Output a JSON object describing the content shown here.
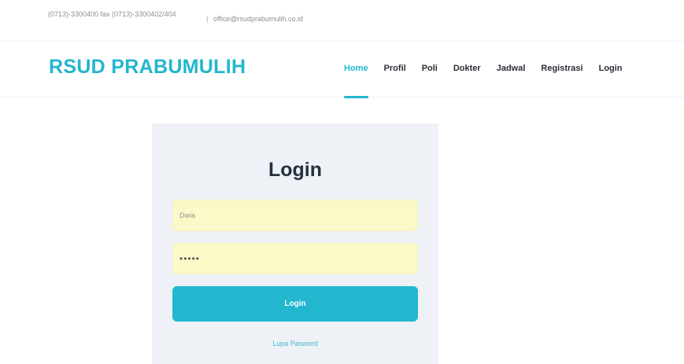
{
  "topbar": {
    "phone": "(0713)-3300400 fax (0713)-3300402/404",
    "separator": "|",
    "email": "office@rsudprabumulih.co.id"
  },
  "header": {
    "brand": "RSUD PRABUMULIH",
    "nav": {
      "home": "Home",
      "profil": "Profil",
      "poli": "Poli",
      "dokter": "Dokter",
      "jadwal": "Jadwal",
      "registrasi": "Registrasi",
      "login": "Login"
    },
    "active_item": "Home"
  },
  "login_form": {
    "title": "Login",
    "username_value": "Dwia",
    "password_value": "•••••",
    "submit_label": "Login",
    "forgot_label": "Lupa Pasword"
  },
  "colors": {
    "accent": "#22b6cf",
    "card_background": "#eef2f7",
    "input_background": "#fcf9c8",
    "heading": "#26303d"
  }
}
